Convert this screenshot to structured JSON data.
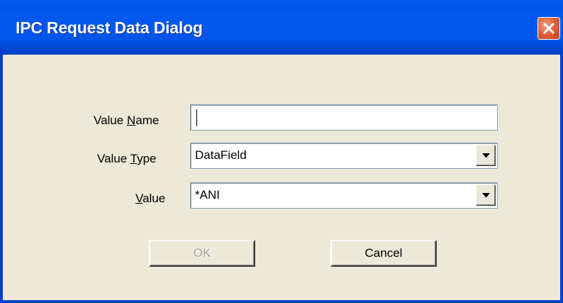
{
  "window": {
    "title": "IPC Request Data Dialog",
    "close_icon": "close-icon"
  },
  "form": {
    "value_name": {
      "label_prefix": "Value ",
      "label_mnemonic": "N",
      "label_suffix": "ame",
      "value": ""
    },
    "value_type": {
      "label_prefix": "Value ",
      "label_mnemonic": "T",
      "label_suffix": "ype",
      "selected": "DataField"
    },
    "value": {
      "label_prefix": "",
      "label_mnemonic": "V",
      "label_suffix": "alue",
      "selected": "*ANI"
    }
  },
  "buttons": {
    "ok_label": "OK",
    "ok_enabled": false,
    "cancel_label": "Cancel"
  },
  "colors": {
    "titlebar": "#0058ee",
    "dialog_bg": "#ece9d8",
    "close_button": "#e2613f",
    "disabled_text": "#a0a0a0"
  }
}
